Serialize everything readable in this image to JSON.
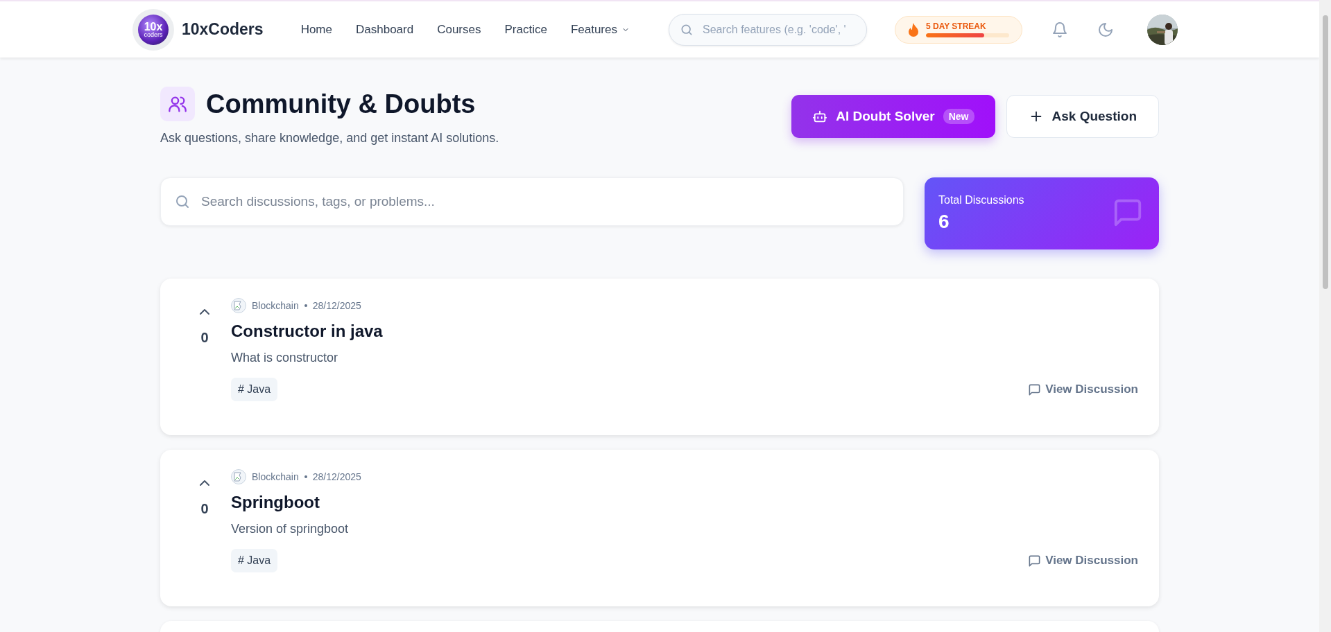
{
  "header": {
    "logo_text": "10x",
    "logo_subtext": "coders",
    "brand": "10xCoders",
    "nav": [
      {
        "label": "Home",
        "kind": "link",
        "selected": false
      },
      {
        "label": "Dashboard",
        "kind": "link",
        "selected": false
      },
      {
        "label": "Courses",
        "kind": "link",
        "selected": false
      },
      {
        "label": "Practice",
        "kind": "link",
        "selected": false
      },
      {
        "label": "Features",
        "kind": "dropdown",
        "selected": false
      }
    ],
    "search": {
      "placeholder": "Search features (e.g. 'code', '"
    },
    "streak": {
      "label": "5 DAY STREAK",
      "level": 0.7
    }
  },
  "page": {
    "title": "Community & Doubts",
    "subtitle": "Ask questions, share knowledge, and get instant AI solutions.",
    "ai_button": {
      "label": "AI Doubt Solver",
      "badge": "New"
    },
    "ask_button": {
      "label": "Ask Question"
    },
    "search": {
      "placeholder": "Search discussions, tags, or problems..."
    },
    "stats": {
      "label": "Total Discussions",
      "value": "6"
    }
  },
  "discussions": [
    {
      "votes": "0",
      "author": "Blockchain",
      "date": "28/12/2025",
      "title": "Constructor in java",
      "body": "What is constructor",
      "tags": [
        "# Java"
      ],
      "action": "View Discussion"
    },
    {
      "votes": "0",
      "author": "Blockchain",
      "date": "28/12/2025",
      "title": "Springboot",
      "body": "Version of springboot",
      "tags": [
        "# Java"
      ],
      "action": "View Discussion"
    }
  ]
}
